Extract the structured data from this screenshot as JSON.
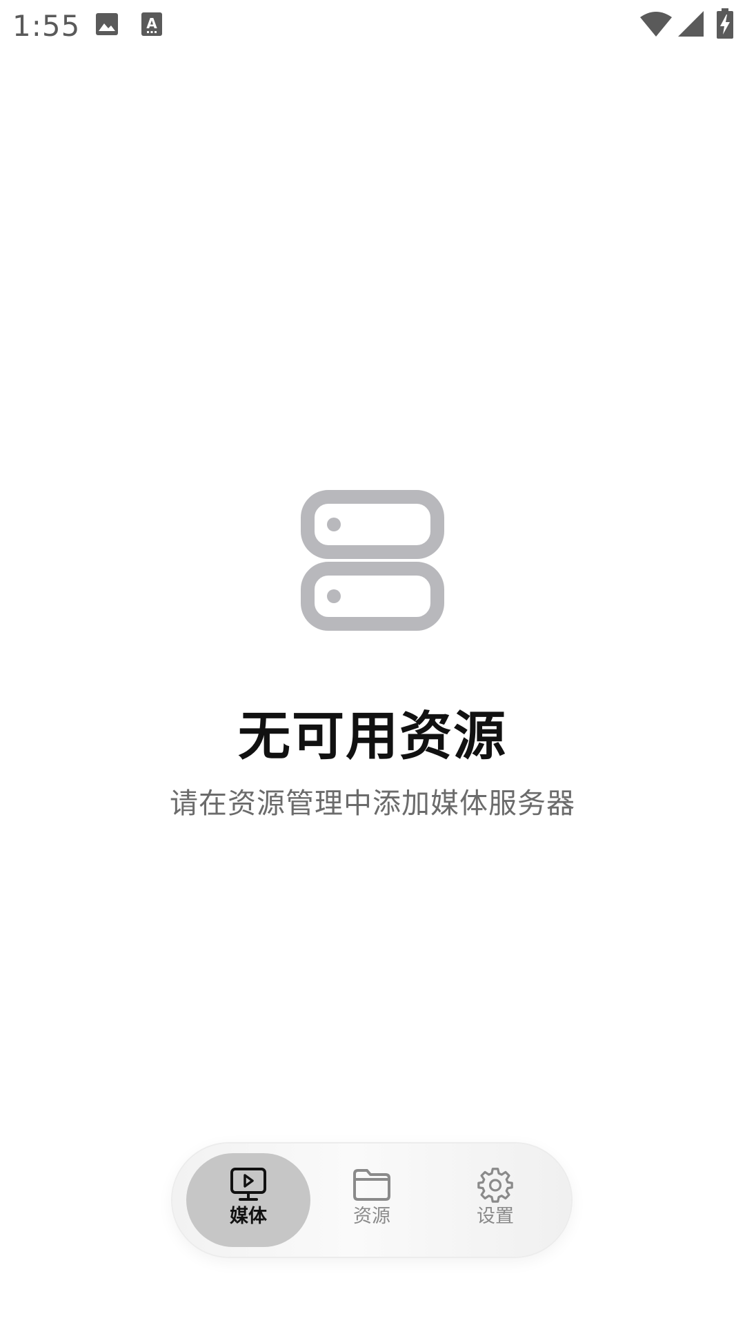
{
  "status_bar": {
    "time": "1:55",
    "icons": [
      "image-icon",
      "keyboard-a-icon",
      "wifi-icon",
      "cell-signal-icon",
      "battery-charging-icon"
    ]
  },
  "empty_state": {
    "icon": "server-icon",
    "title": "无可用资源",
    "subtitle": "请在资源管理中添加媒体服务器"
  },
  "bottom_nav": {
    "items": [
      {
        "label": "媒体",
        "icon": "monitor-play-icon",
        "active": true
      },
      {
        "label": "资源",
        "icon": "folder-icon",
        "active": false
      },
      {
        "label": "设置",
        "icon": "gear-icon",
        "active": false
      }
    ]
  },
  "colors": {
    "background": "#ffffff",
    "icon_gray": "#b8b8bc",
    "title": "#111111",
    "subtitle": "#6b6b6b",
    "nav_active_pill": "#c6c6c6",
    "nav_inactive": "#8a8a8a"
  }
}
